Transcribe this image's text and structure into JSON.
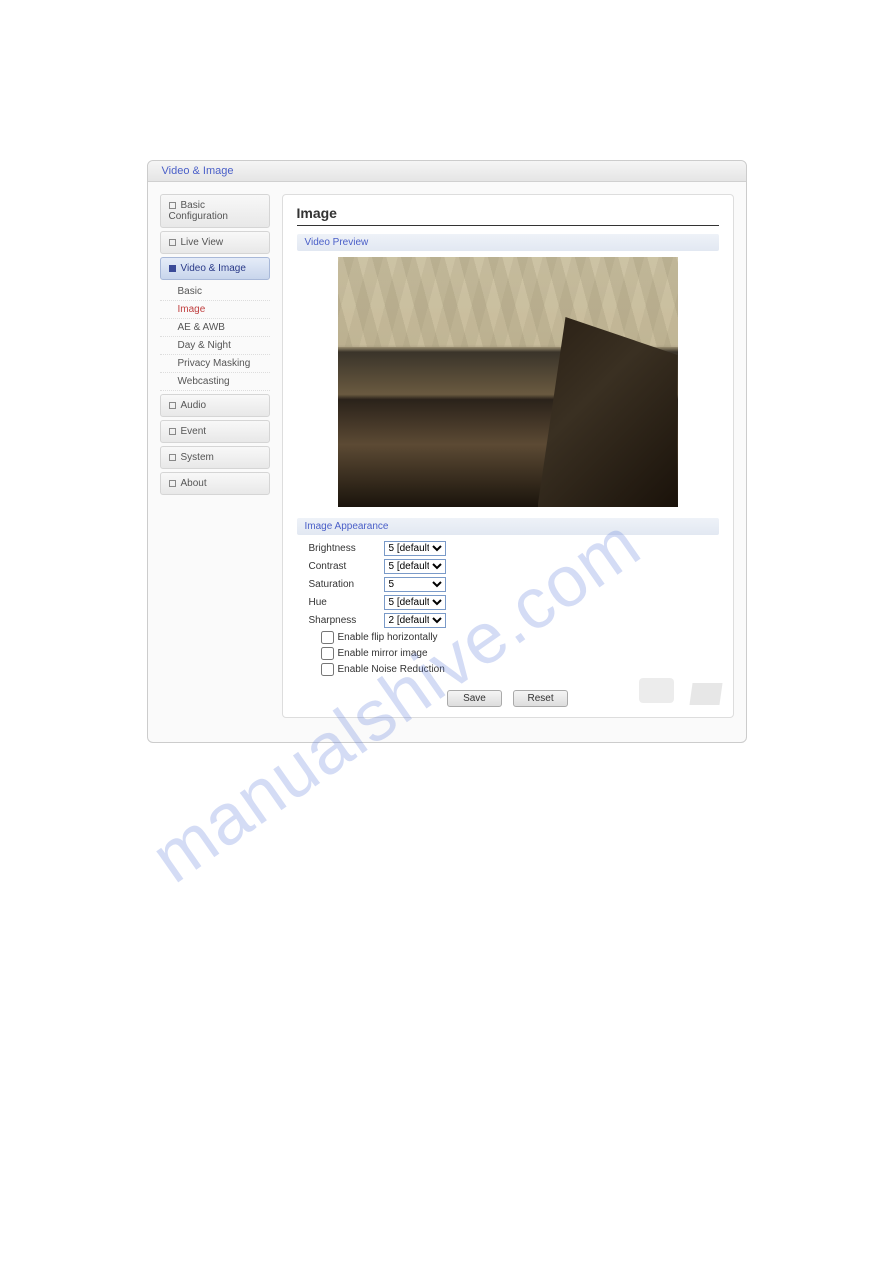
{
  "titlebar": {
    "title": "Video & Image"
  },
  "sidebar": {
    "items": [
      {
        "label": "Basic Configuration"
      },
      {
        "label": "Live View"
      },
      {
        "label": "Video & Image"
      },
      {
        "label": "Audio"
      },
      {
        "label": "Event"
      },
      {
        "label": "System"
      },
      {
        "label": "About"
      }
    ],
    "sub": [
      {
        "label": "Basic"
      },
      {
        "label": "Image"
      },
      {
        "label": "AE & AWB"
      },
      {
        "label": "Day & Night"
      },
      {
        "label": "Privacy Masking"
      },
      {
        "label": "Webcasting"
      }
    ]
  },
  "content": {
    "heading": "Image",
    "preview_label": "Video Preview",
    "appearance_label": "Image Appearance",
    "fields": {
      "brightness": {
        "label": "Brightness",
        "value": "5 [default]"
      },
      "contrast": {
        "label": "Contrast",
        "value": "5 [default]"
      },
      "saturation": {
        "label": "Saturation",
        "value": "5"
      },
      "hue": {
        "label": "Hue",
        "value": "5 [default]"
      },
      "sharpness": {
        "label": "Sharpness",
        "value": "2 [default]"
      }
    },
    "checks": {
      "flip": "Enable flip horizontally",
      "mirror": "Enable mirror image",
      "noise": "Enable Noise Reduction"
    },
    "buttons": {
      "save": "Save",
      "reset": "Reset"
    }
  },
  "watermark": "manualshive.com"
}
